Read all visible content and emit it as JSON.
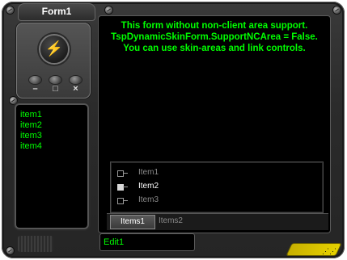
{
  "window": {
    "title": "Form1"
  },
  "info_lines": [
    "This form without non-client area support.",
    "TspDynamicSkinForm.SupportNCArea = False.",
    "You can use skin-areas and link controls."
  ],
  "caption_buttons": {
    "minimize": "–",
    "maximize": "□",
    "close": "×"
  },
  "list": {
    "items": [
      "item1",
      "item2",
      "item3",
      "item4"
    ]
  },
  "tree": {
    "items": [
      "Item1",
      "Item2",
      "Item3"
    ],
    "selected": "Item2"
  },
  "tabs": {
    "items": [
      "Items1",
      "Items2"
    ],
    "active": "Items1"
  },
  "edit": {
    "value": "Edit1"
  },
  "colors": {
    "accent_text": "#00ff00",
    "lightning": "#ffcc00",
    "corner_accent": "#e6d200"
  },
  "icons": {
    "app_button": "lightning-icon"
  }
}
